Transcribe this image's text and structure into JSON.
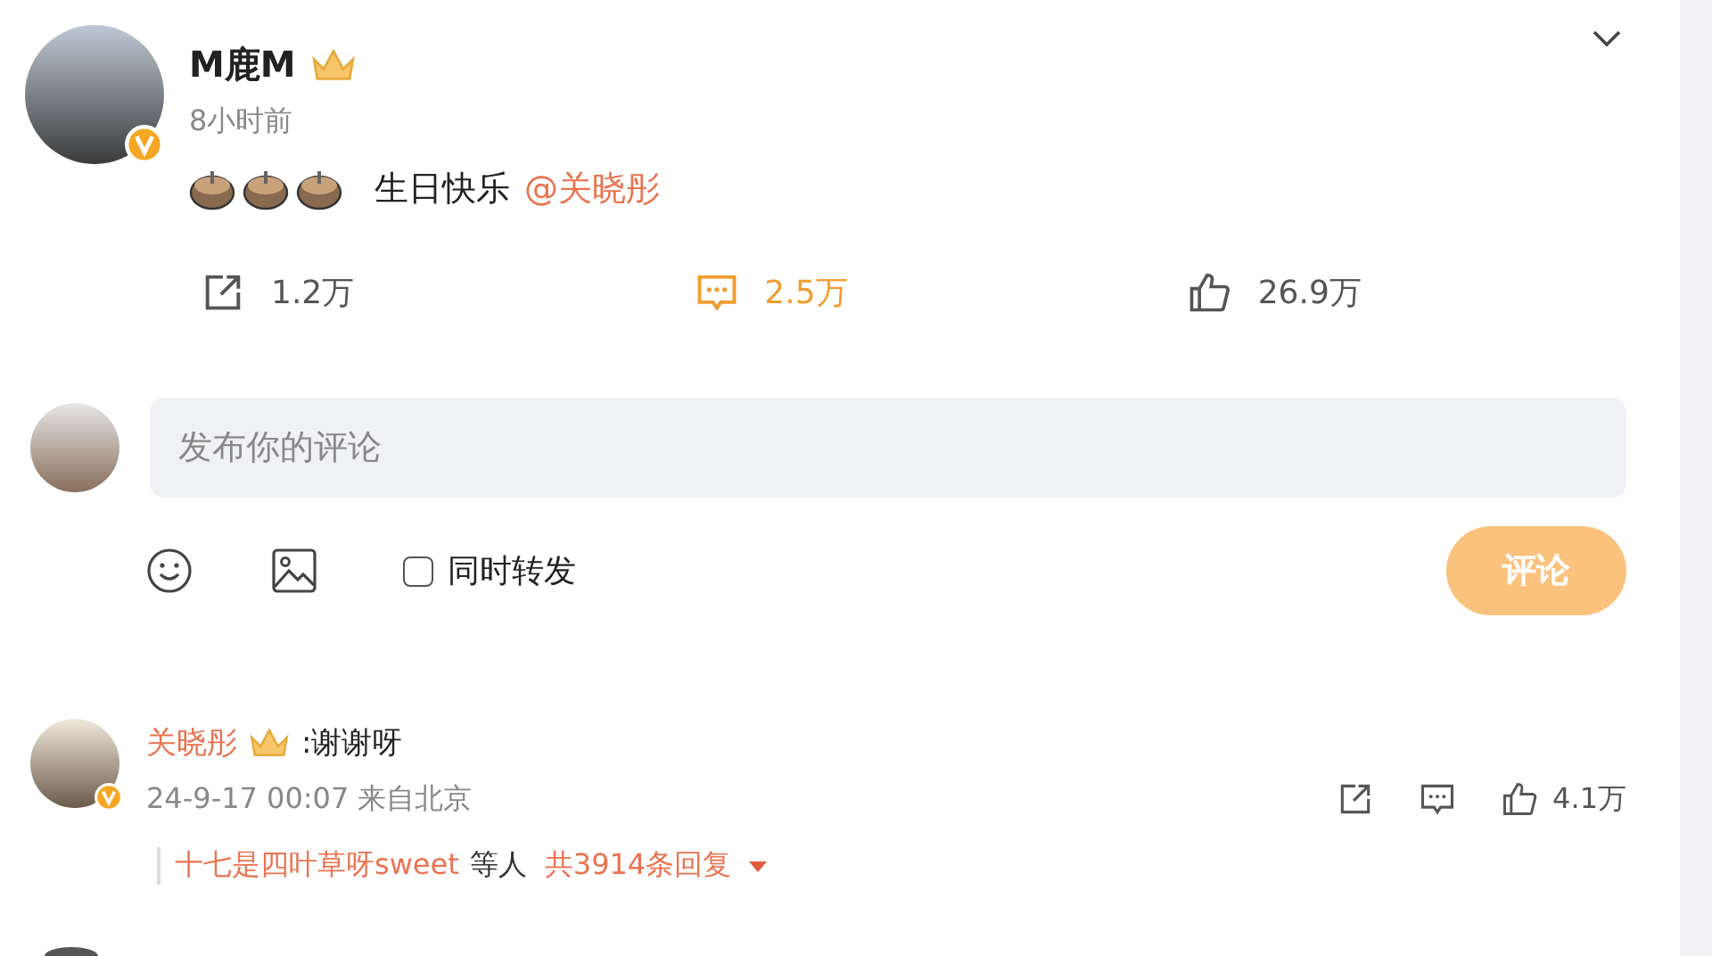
{
  "post": {
    "author": "M鹿M",
    "time": "8小时前",
    "text": "生日快乐",
    "mention": "@关晓彤",
    "stats": [
      {
        "kind": "share",
        "count": "1.2万",
        "selected": false
      },
      {
        "kind": "comment",
        "count": "2.5万",
        "selected": true
      },
      {
        "kind": "like",
        "count": "26.9万",
        "selected": false
      }
    ]
  },
  "composer": {
    "placeholder": "发布你的评论",
    "repost_label": "同时转发",
    "repost_checked": false,
    "submit": "评论"
  },
  "comments": [
    {
      "author": "关晓彤",
      "text": ":谢谢呀",
      "meta": "24-9-17 00:07 来自北京",
      "likes": "4.1万",
      "replies_by": "十七是四叶草呀sweet",
      "replies_mid": "等人",
      "replies_count": "共3914条回复"
    }
  ]
}
